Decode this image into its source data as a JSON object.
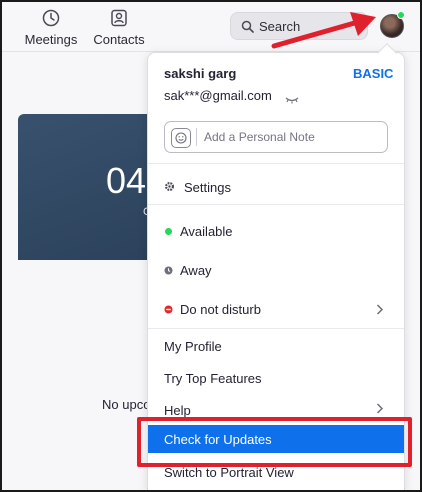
{
  "nav": {
    "meetings_label": "Meetings",
    "contacts_label": "Contacts"
  },
  "search": {
    "label": "Search"
  },
  "background": {
    "card_time": "04",
    "card_sub": "C",
    "no_upcoming": "No upco"
  },
  "menu": {
    "user_name": "sakshi garg",
    "plan": "BASIC",
    "email": "sak***@gmail.com",
    "note_placeholder": "Add a Personal Note",
    "items": {
      "settings": "Settings",
      "available": "Available",
      "away": "Away",
      "dnd": "Do not disturb",
      "my_profile": "My Profile",
      "try_features": "Try Top Features",
      "help": "Help",
      "check_updates": "Check for Updates",
      "portrait": "Switch to Portrait View"
    }
  },
  "colors": {
    "accent": "#0e71eb",
    "available": "#23d959",
    "away": "#6e6e7a",
    "dnd": "#e02828",
    "annotation": "#e0202d"
  },
  "icons": [
    "clock-icon",
    "contacts-icon",
    "search-icon",
    "avatar",
    "eye-closed-icon",
    "emoji-icon",
    "gear-icon",
    "chevron-right-icon"
  ]
}
